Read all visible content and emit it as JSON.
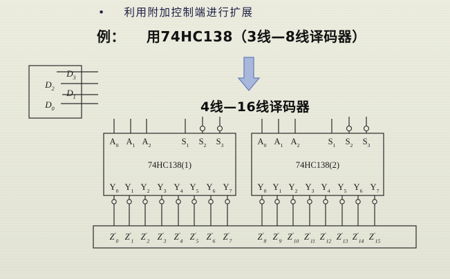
{
  "header": {
    "bullet": "•",
    "title": "利用附加控制端进行扩展",
    "example_label": "例：",
    "example_text": "用74HC138（3线—8线译码器）"
  },
  "subtitle": "4线—16线译码器",
  "input_block": {
    "labels": [
      {
        "base": "D",
        "sub": "3"
      },
      {
        "base": "D",
        "sub": "2"
      },
      {
        "base": "D",
        "sub": "1"
      },
      {
        "base": "D",
        "sub": "0"
      }
    ]
  },
  "decoders": [
    {
      "name": "74HC138(1)",
      "inputs": [
        {
          "base": "A",
          "sub": "0"
        },
        {
          "base": "A",
          "sub": "1"
        },
        {
          "base": "A",
          "sub": "2"
        },
        {
          "base": "S",
          "sub": "1"
        },
        {
          "base": "S",
          "sub": "2"
        },
        {
          "base": "S",
          "sub": "3"
        }
      ],
      "outputs": [
        {
          "base": "Y",
          "sub": "0"
        },
        {
          "base": "Y",
          "sub": "1"
        },
        {
          "base": "Y",
          "sub": "2"
        },
        {
          "base": "Y",
          "sub": "3"
        },
        {
          "base": "Y",
          "sub": "4"
        },
        {
          "base": "Y",
          "sub": "5"
        },
        {
          "base": "Y",
          "sub": "6"
        },
        {
          "base": "Y",
          "sub": "7"
        }
      ]
    },
    {
      "name": "74HC138(2)",
      "inputs": [
        {
          "base": "A",
          "sub": "0"
        },
        {
          "base": "A",
          "sub": "1"
        },
        {
          "base": "A",
          "sub": "2"
        },
        {
          "base": "S",
          "sub": "1"
        },
        {
          "base": "S",
          "sub": "2"
        },
        {
          "base": "S",
          "sub": "3"
        }
      ],
      "outputs": [
        {
          "base": "Y",
          "sub": "0"
        },
        {
          "base": "Y",
          "sub": "1"
        },
        {
          "base": "Y",
          "sub": "2"
        },
        {
          "base": "Y",
          "sub": "3"
        },
        {
          "base": "Y",
          "sub": "4"
        },
        {
          "base": "Y",
          "sub": "5"
        },
        {
          "base": "Y",
          "sub": "6"
        },
        {
          "base": "Y",
          "sub": "7"
        }
      ]
    }
  ],
  "output_bus": {
    "labels": [
      {
        "base": "Z",
        "sup": "′",
        "sub": "0"
      },
      {
        "base": "Z",
        "sup": "′",
        "sub": "1"
      },
      {
        "base": "Z",
        "sup": "′",
        "sub": "2"
      },
      {
        "base": "Z",
        "sup": "′",
        "sub": "3"
      },
      {
        "base": "Z",
        "sup": "′",
        "sub": "4"
      },
      {
        "base": "Z",
        "sup": "′",
        "sub": "5"
      },
      {
        "base": "Z",
        "sup": "′",
        "sub": "6"
      },
      {
        "base": "Z",
        "sup": "′",
        "sub": "7"
      },
      {
        "base": "Z",
        "sup": "′",
        "sub": "8"
      },
      {
        "base": "Z",
        "sup": "′",
        "sub": "9"
      },
      {
        "base": "Z",
        "sup": "′",
        "sub": "10"
      },
      {
        "base": "Z",
        "sup": "′",
        "sub": "11"
      },
      {
        "base": "Z",
        "sup": "′",
        "sub": "12"
      },
      {
        "base": "Z",
        "sup": "′",
        "sub": "13"
      },
      {
        "base": "Z",
        "sup": "′",
        "sub": "14"
      },
      {
        "base": "Z",
        "sup": "′",
        "sub": "15"
      }
    ]
  },
  "colors": {
    "arrow_fill": "#a8b8dc",
    "arrow_stroke": "#6b7fb6",
    "line": "#2a2a2a"
  }
}
